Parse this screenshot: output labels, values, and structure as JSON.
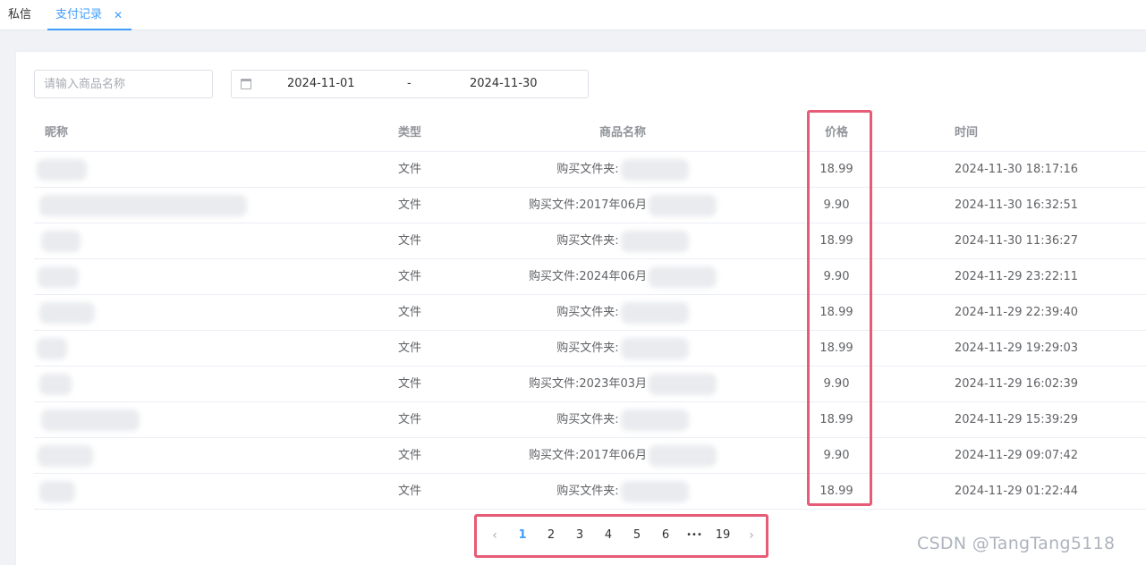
{
  "tabs": [
    {
      "label": "私信"
    },
    {
      "label": "支付记录",
      "close": "✕"
    }
  ],
  "filters": {
    "product_placeholder": "请输入商品名称",
    "date_start": "2024-11-01",
    "date_separator": "-",
    "date_end": "2024-11-30"
  },
  "table": {
    "columns": [
      "昵称",
      "类型",
      "商品名称",
      "价格",
      "时间"
    ],
    "rows": [
      {
        "type": "文件",
        "product": "购买文件夹:",
        "price": "18.99",
        "time": "2024-11-30 18:17:16"
      },
      {
        "type": "文件",
        "product": "购买文件:2017年06月",
        "price": "9.90",
        "time": "2024-11-30 16:32:51"
      },
      {
        "type": "文件",
        "product": "购买文件夹:",
        "price": "18.99",
        "time": "2024-11-30 11:36:27"
      },
      {
        "type": "文件",
        "product": "购买文件:2024年06月",
        "price": "9.90",
        "time": "2024-11-29 23:22:11"
      },
      {
        "type": "文件",
        "product": "购买文件夹:",
        "price": "18.99",
        "time": "2024-11-29 22:39:40"
      },
      {
        "type": "文件",
        "product": "购买文件夹:",
        "price": "18.99",
        "time": "2024-11-29 19:29:03"
      },
      {
        "type": "文件",
        "product": "购买文件:2023年03月",
        "price": "9.90",
        "time": "2024-11-29 16:02:39"
      },
      {
        "type": "文件",
        "product": "购买文件夹:",
        "price": "18.99",
        "time": "2024-11-29 15:39:29"
      },
      {
        "type": "文件",
        "product": "购买文件:2017年06月",
        "price": "9.90",
        "time": "2024-11-29 09:07:42"
      },
      {
        "type": "文件",
        "product": "购买文件夹:",
        "price": "18.99",
        "time": "2024-11-29 01:22:44"
      }
    ]
  },
  "pagination": {
    "prev": "‹",
    "pages": [
      "1",
      "2",
      "3",
      "4",
      "5",
      "6"
    ],
    "ellipsis": "•••",
    "last": "19",
    "next": "›",
    "current": "1"
  },
  "watermark": "CSDN @TangTang5118",
  "colors": {
    "accent": "#409eff",
    "highlight": "#e65b75"
  }
}
